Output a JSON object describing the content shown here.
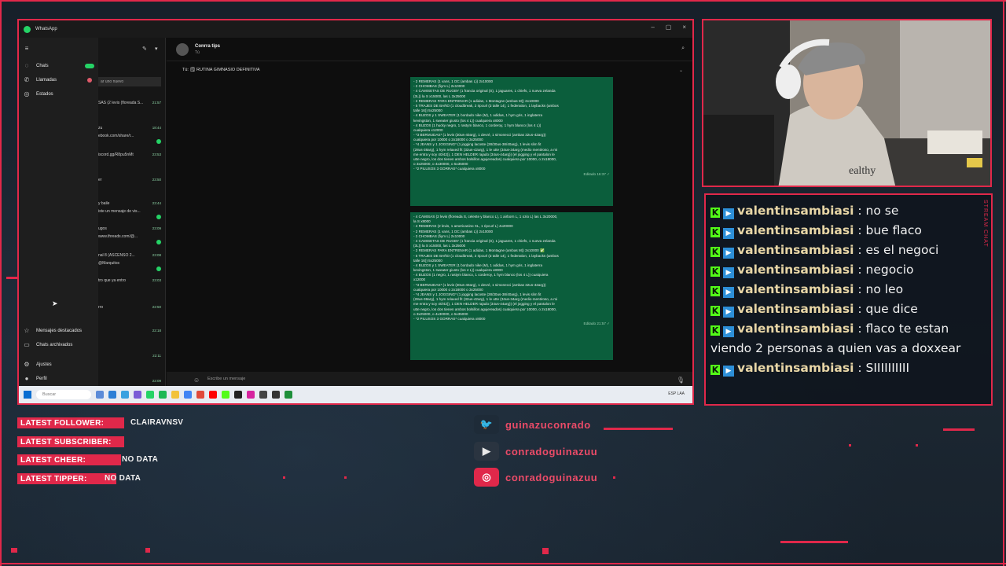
{
  "whatsapp": {
    "app_title": "WhatsApp",
    "window_controls": [
      "–",
      "▢",
      "×"
    ],
    "rail": [
      {
        "label": "Chats"
      },
      {
        "label": "Llamadas"
      },
      {
        "label": "Estados"
      },
      {
        "label": "Mensajes destacados"
      },
      {
        "label": "Chats archivados"
      },
      {
        "label": "Ajustes"
      },
      {
        "label": "Perfil"
      }
    ],
    "list_search_text": "ar uno nuevo",
    "chat_rows": [
      {
        "snippet": "SAS (2 levis (floreada S...",
        "time": "21:57"
      },
      {
        "snippet": "zu",
        "time": "18:44"
      },
      {
        "snippet": "ebook.com/share/r...",
        "time": ""
      },
      {
        "snippet": "iscord.gg/R8pu5nMt",
        "time": "23:53"
      },
      {
        "snippet": "er",
        "time": "23:50"
      },
      {
        "snippet": "y baile",
        "time": "23:44"
      },
      {
        "snippet": "iste un mensaje de vis...",
        "time": ""
      },
      {
        "snippet": "ugos",
        "time": "23:09"
      },
      {
        "snippet": "www.threads.com/@...",
        "time": ""
      },
      {
        "snippet": "nal 8 (ASCENSO 2...",
        "time": "23:08"
      },
      {
        "snippet": "@Marquitos",
        "time": ""
      },
      {
        "snippet": "tro que ya entro",
        "time": "23:03"
      },
      {
        "snippet": "rro",
        "time": "22:50"
      },
      {
        "snippet": "",
        "time": "22:18"
      },
      {
        "snippet": "",
        "time": "22:11"
      },
      {
        "snippet": "",
        "time": "22:09"
      }
    ],
    "contact_name": "Conrra tips",
    "contact_sub": "Tú",
    "pinned_text": "Tú: 🗒 RUTINA GIMNASIO DEFINITIVA",
    "bubble1_lines": [
      "- 2 REMERAS (1 vans, 1 DC (ambas L)) 2x10000",
      "- 2 CHOMBAS (fiym L) 2x10000",
      "- 4 CAMISETAS DE RUGBY (1 francia original (S), 1 jaguares, 1 chiefs, 1 nueva zelanda",
      "(3L)) la S x15000, las L 3x25000",
      "- 2 REMERAS PARA ENTRENAR (1 adidas, 1 Montagne (ambas M)) 2x10000",
      "- 5 TRAJES DE BAÑO (1 cloudbreak, 2 ripcurl (3 talle 14), 1 federation, 1 laybacks (ambos",
      "talle 16)) 5x25000",
      "- 4 BUZOS y 1 SWEATER (1 bordado nike (M), 1 adidas, 1 hym gris, 1 inglaterra",
      "kevingston, 1 sweater giusto (los 4 L)) cualquiera x8000",
      "- 4 BUZOS (1 hucky negro, 1 rastym blanco, 1 corderoy, 1 hym blanco (los 4 L))",
      "cualquiera x12000",
      "- *3 BERMUDAS* (1 levis (30us-40arg), 1 devré, 1 simonecci (ambas 32us-42arg))",
      "cualquiera por 10000 o 2x18000 o 3x25000",
      "- *4 JEANS y 1 JOGGING* (1 jogging lacoste (28/30us-38/40arg), 1 levis slim fit",
      "(28us-38arg), 1 hym relaxed fit (32us-42arg), 1 le utte (34us-34arg (medio mentiroso, a mi",
      "me entra y soy 40/42)), 1 DEN HELDER rajado (34us-44arg)) (el jogging y el pantalon le",
      "utte negro, los dos tienen ambos bolsillos agujereados) cualquiera por 10000, o 2x18000,",
      "o 3x25000, o 4x30000, o 5x35000",
      "- *2 PILUSOS 3 GORRAS* cualquiera x8000"
    ],
    "bubble1_meta": "Editado 16:37 ✓",
    "bubble2_lines": [
      "- 4 CAMISAS (2 levis (floreada S, celeste y blanco L), 1 airborn L, 1 ozio L) las L 3x20000,",
      "la S x8000",
      "- 4 REMERAS (2 levis, 1 americanino XL, 1 ripcurl L) 4x20000",
      "- 2 REMERAS (1 vans, 1 DC (ambas L)) 2x10000",
      "- 2 CHOMBAS (fiym L) 2x10000",
      "- 4 CAMISETAS DE RUGBY (1 francia original (S), 1 jaguares, 1 chiefs, 1 nueva zelanda",
      "(3L)) la S x15000, las L 3x25000",
      "- 2 REMERAS PARA ENTRENAR (1 adidas, 1 Montagne (ambas M)) 2x10000 ✅",
      "- 5 TRAJES DE BAÑO (1 cloudbreak, 2 ripcurl (3 talle 14), 1 federation, 1 laybacks (ambos",
      "talle 16)) 5x25000",
      "- 4 BUZOS y 1 SWEATER (1 bordado nike (M), 1 adidas, 1 hym gris, 1 inglaterra",
      "kevingston, 1 sweater giusto (los 4 L)) cualquiera x8000",
      "- 4 BUZOS (1 negro, 1 rastym blanco, 1 corderoy, 1 hym blanco (los 4 L)) cualquiera",
      "x12000",
      "- *3 BERMUDAS* (1 levis (30us-40arg), 1 devré, 1 simonecci (ambas 32us-42arg))",
      "cualquiera por 10000 o 2x18000 o 3x25000",
      "- *4 JEANS y 1 JOGGING* (1 jogging lacoste (28/30us-38/40arg), 1 levis slim fit",
      "(28us-38arg), 1 hym relaxed fit (32us-42arg), 1 le utte (34us-34arg (medio mentiroso, a mi",
      "me entra y soy 40/42)), 1 DEN HELDER rajado (34us-44arg)) (el jogging y el pantalon le",
      "utte negro, los dos tienen ambos bolsillos agujereados) cualquiera por 10000, o 2x18000,",
      "o 3x25000, o 4x30000, o 5x35000",
      "- *2 PILUSOS 3 GORRAS* cualquiera x8000"
    ],
    "bubble2_meta": "Editado 21:57 ✓",
    "input_placeholder": "Escribe un mensaje",
    "taskbar_search": "Buscar",
    "taskbar_tray": "ESP LAA"
  },
  "chat": {
    "side_label": "STREAM CHAT",
    "messages": [
      {
        "user": "valentinsambiasi",
        "text": " : no se"
      },
      {
        "user": "valentinsambiasi",
        "text": " : bue flaco"
      },
      {
        "user": "valentinsambiasi",
        "text": " : es el negoci"
      },
      {
        "user": "valentinsambiasi",
        "text": " : negocio"
      },
      {
        "user": "valentinsambiasi",
        "text": " : no leo"
      },
      {
        "user": "valentinsambiasi",
        "text": " : que dice"
      },
      {
        "user": "valentinsambiasi",
        "text": " : flaco te estan viendo 2 personas a quien vas a doxxear"
      },
      {
        "user": "valentinsambiasi",
        "text": " : SIIIIIIIIII"
      }
    ]
  },
  "stats": [
    {
      "label": "LATEST FOLLOWER:",
      "value": "CLAIRAVNSV"
    },
    {
      "label": "LATEST SUBSCRIBER:",
      "value": ""
    },
    {
      "label": "LATEST CHEER:",
      "value": "NO DATA"
    },
    {
      "label": "LATEST TIPPER:",
      "value": "NO DATA"
    }
  ],
  "socials": [
    {
      "icon": "twitter-icon",
      "glyph": "🐦",
      "handle": "guinazuconrado"
    },
    {
      "icon": "youtube-icon",
      "glyph": "▶",
      "handle": "conradoguinazuu"
    },
    {
      "icon": "instagram-icon",
      "glyph": "◎",
      "handle": "conradoguinazuu"
    }
  ],
  "colors": {
    "accent": "#e0284a",
    "wa_green": "#0b5e3c",
    "kick_green": "#53fc18"
  }
}
